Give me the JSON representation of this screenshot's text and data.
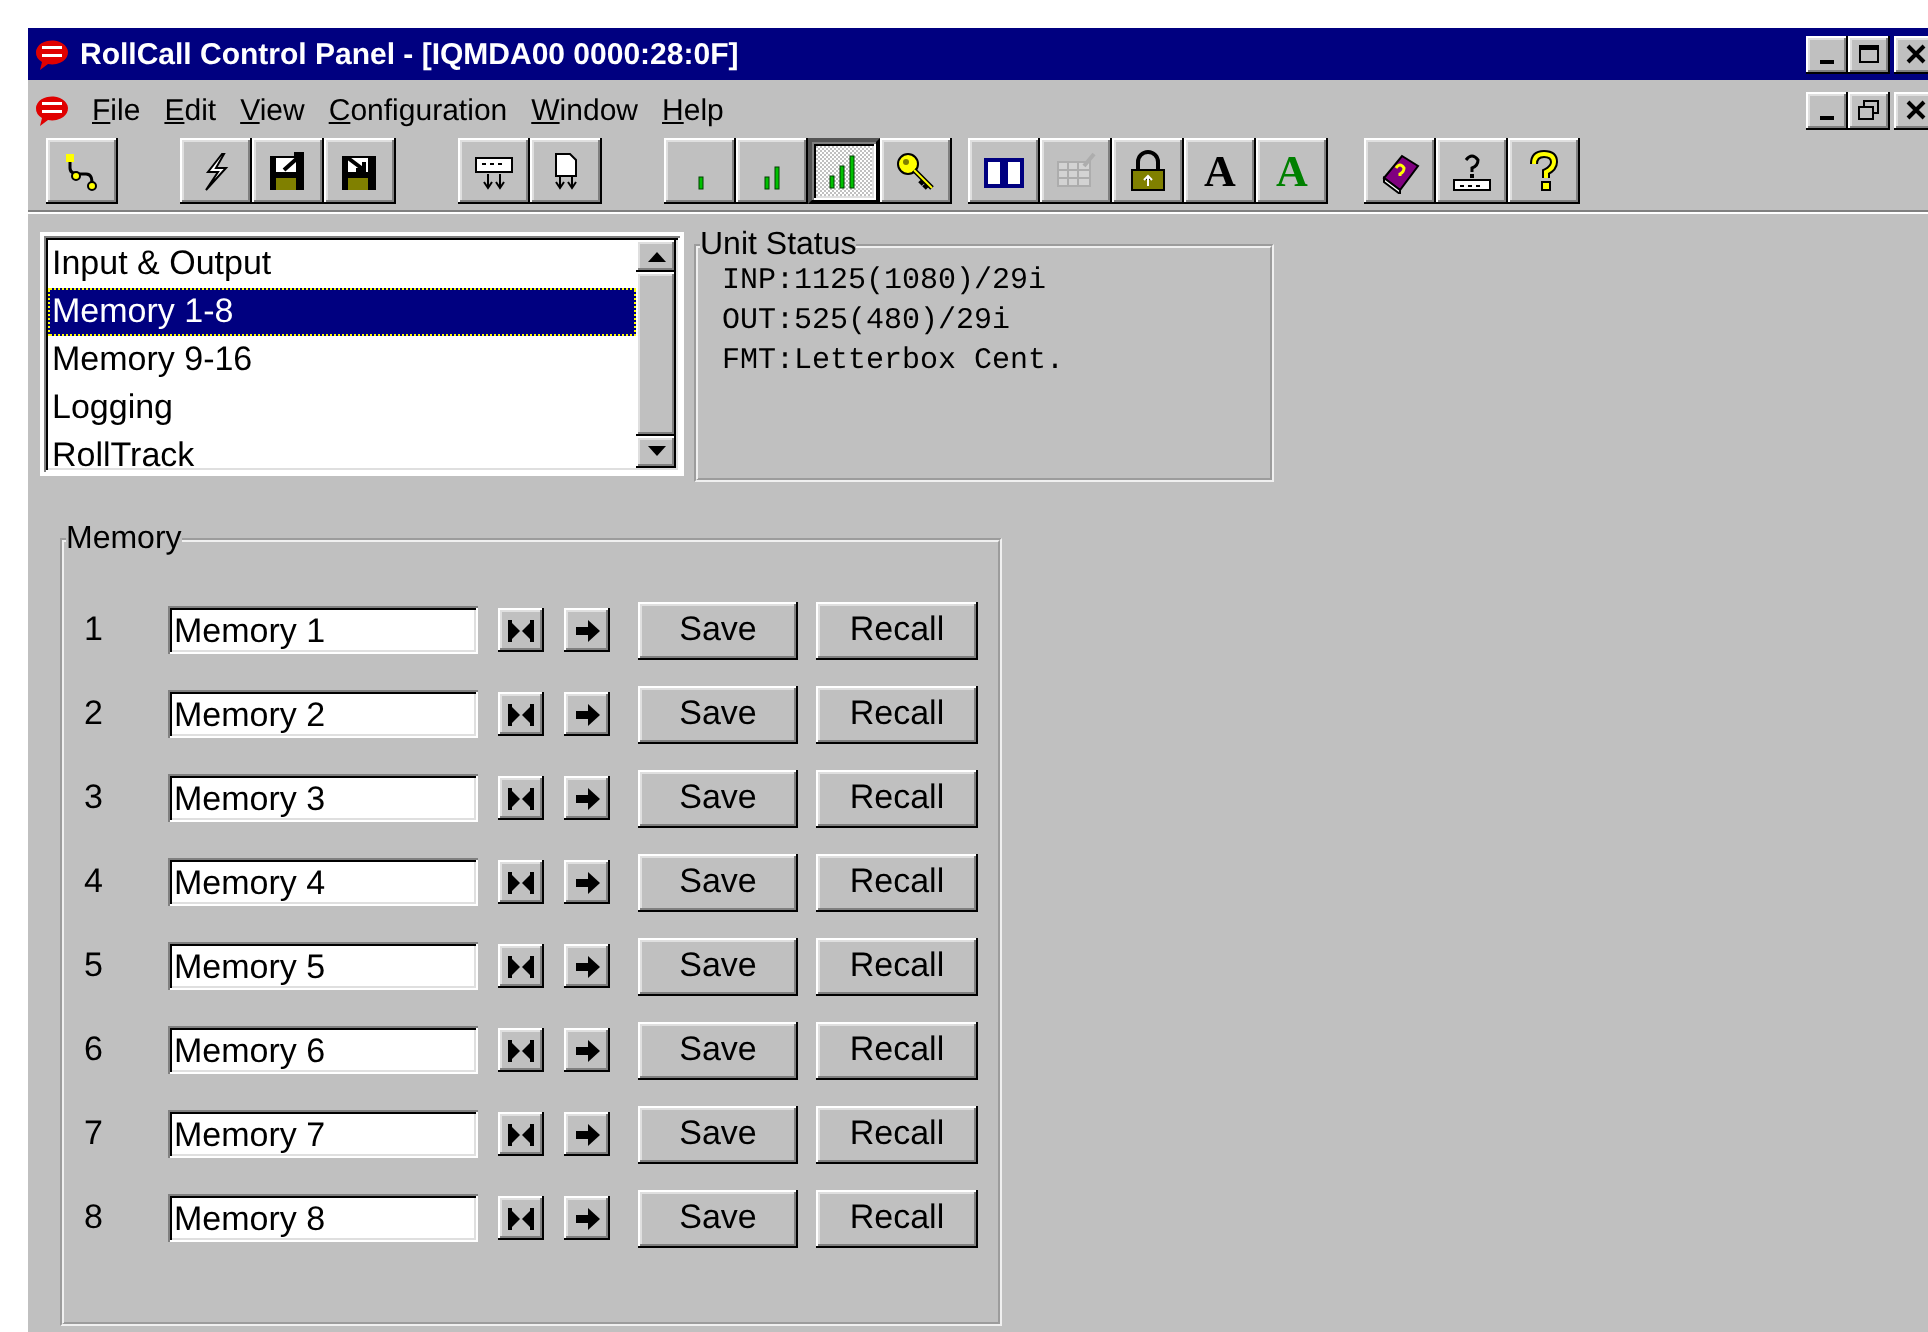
{
  "window": {
    "title": "RollCall Control Panel - [IQMDA00 0000:28:0F]"
  },
  "menu": [
    {
      "label": "File"
    },
    {
      "label": "Edit"
    },
    {
      "label": "View"
    },
    {
      "label": "Configuration"
    },
    {
      "label": "Window"
    },
    {
      "label": "Help"
    }
  ],
  "toolbar": {
    "groups": [
      {
        "buttons": [
          {
            "kind": "connect",
            "pressed": false,
            "disabled": false
          }
        ]
      },
      {
        "buttons": [
          {
            "kind": "flash",
            "pressed": false,
            "disabled": false
          },
          {
            "kind": "disk-out",
            "pressed": false,
            "disabled": false
          },
          {
            "kind": "disk-in",
            "pressed": false,
            "disabled": false
          }
        ]
      },
      {
        "buttons": [
          {
            "kind": "device-down",
            "pressed": false,
            "disabled": false
          },
          {
            "kind": "page-down",
            "pressed": false,
            "disabled": false
          }
        ]
      },
      {
        "buttons": [
          {
            "kind": "bars-1",
            "pressed": false,
            "disabled": false
          },
          {
            "kind": "bars-2",
            "pressed": false,
            "disabled": false
          },
          {
            "kind": "bars-3",
            "pressed": true,
            "disabled": false
          },
          {
            "kind": "key",
            "pressed": false,
            "disabled": false
          }
        ]
      },
      {
        "buttons": [
          {
            "kind": "book",
            "pressed": false,
            "disabled": false
          },
          {
            "kind": "grid",
            "pressed": false,
            "disabled": true
          },
          {
            "kind": "lock",
            "pressed": false,
            "disabled": false
          },
          {
            "kind": "letter",
            "label": "A",
            "color": "#000000",
            "pressed": false,
            "disabled": false
          },
          {
            "kind": "letter",
            "label": "A",
            "color": "#008000",
            "pressed": false,
            "disabled": false
          }
        ]
      },
      {
        "buttons": [
          {
            "kind": "help-book",
            "pressed": false,
            "disabled": false
          },
          {
            "kind": "keyboard-help",
            "pressed": false,
            "disabled": false
          },
          {
            "kind": "question",
            "pressed": false,
            "disabled": false
          }
        ]
      }
    ]
  },
  "pages": {
    "items": [
      {
        "label": "Input & Output",
        "selected": false
      },
      {
        "label": "Memory 1-8",
        "selected": true
      },
      {
        "label": "Memory 9-16",
        "selected": false
      },
      {
        "label": "Logging",
        "selected": false
      },
      {
        "label": "RollTrack",
        "selected": false
      }
    ]
  },
  "unit_status": {
    "title": "Unit Status",
    "lines": [
      "INP:1125(1080)/29i",
      "OUT:525(480)/29i",
      "FMT:Letterbox Cent."
    ]
  },
  "memory": {
    "title": "Memory",
    "rows": [
      {
        "number": "1",
        "name": "Memory 1",
        "save": "Save",
        "recall": "Recall"
      },
      {
        "number": "2",
        "name": "Memory 2",
        "save": "Save",
        "recall": "Recall"
      },
      {
        "number": "3",
        "name": "Memory 3",
        "save": "Save",
        "recall": "Recall"
      },
      {
        "number": "4",
        "name": "Memory 4",
        "save": "Save",
        "recall": "Recall"
      },
      {
        "number": "5",
        "name": "Memory 5",
        "save": "Save",
        "recall": "Recall"
      },
      {
        "number": "6",
        "name": "Memory 6",
        "save": "Save",
        "recall": "Recall"
      },
      {
        "number": "7",
        "name": "Memory 7",
        "save": "Save",
        "recall": "Recall"
      },
      {
        "number": "8",
        "name": "Memory 8",
        "save": "Save",
        "recall": "Recall"
      }
    ]
  }
}
